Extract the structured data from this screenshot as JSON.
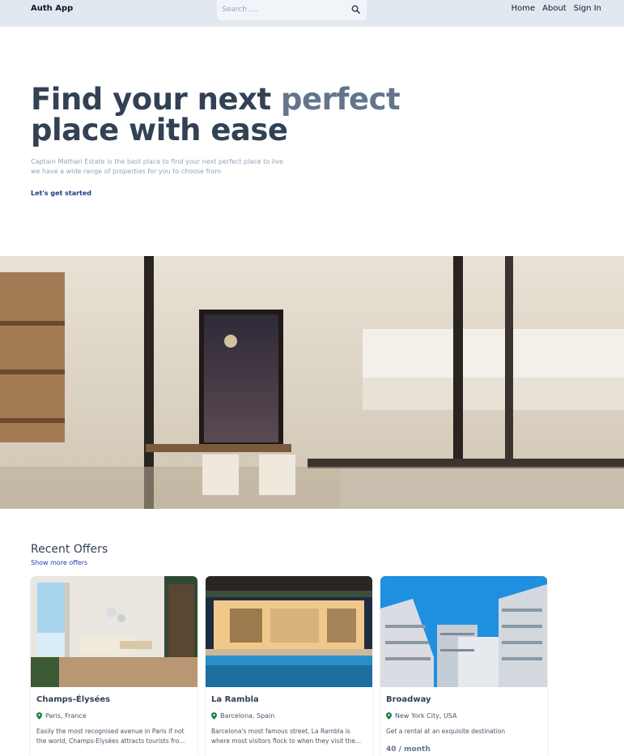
{
  "header": {
    "brand": "Auth App",
    "search_placeholder": "Search ....",
    "nav": [
      "Home",
      "About",
      "Sign In"
    ]
  },
  "hero": {
    "title_part1": "Find your next ",
    "title_accent": "perfect",
    "title_part2": "place with ease",
    "subtitle_line1": "Captain Mathari Estate is the best place to find your next perfect place to live",
    "subtitle_line2": "we have a wide range of properties for you to choose from",
    "cta": "Let's get started"
  },
  "offers": {
    "title": "Recent Offers",
    "more_link": "Show more offers",
    "listings": [
      {
        "name": "Champs-Élysées",
        "location": "Paris, France",
        "description": "Easily the most recognised avenue in Paris if not the world, Champs-Elysées attracts tourists fro...",
        "price": ""
      },
      {
        "name": "La Rambla",
        "location": "Barcelona, Spain",
        "description": "Barcelona's most famous street, La Rambla is where most visitors flock to when they visit the...",
        "price": ""
      },
      {
        "name": "Broadway",
        "location": "New York City, USA",
        "description": "Get a rental at an exquisite destination",
        "price": "40 / month"
      }
    ]
  },
  "colors": {
    "header_bg": "#e2e8f0",
    "title": "#334155",
    "accent": "#64748b",
    "link": "#1e3a8a",
    "pin": "#15803d"
  }
}
